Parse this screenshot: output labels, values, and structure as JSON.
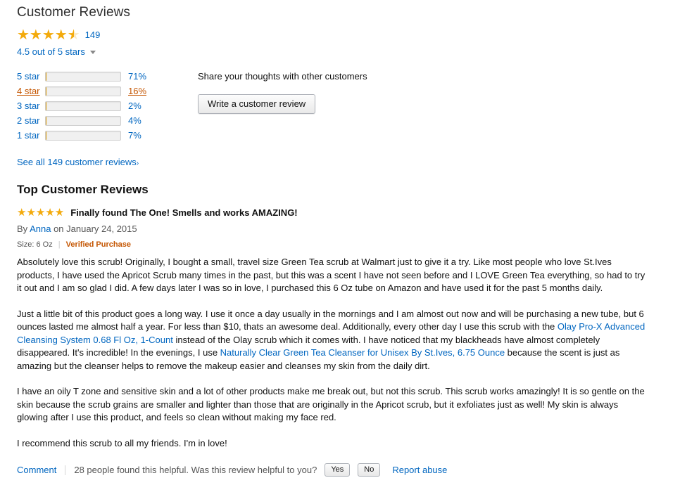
{
  "section": {
    "heading": "Customer Reviews",
    "top_reviews_heading": "Top Customer Reviews"
  },
  "summary": {
    "rating_value": 4.5,
    "rating_max": 5,
    "review_count_label": "149",
    "rating_text": "4.5 out of 5 stars",
    "see_all_label": "See all 149 customer reviews",
    "see_all_arrow": "›"
  },
  "share": {
    "prompt": "Share your thoughts with other customers",
    "write_review_label": "Write a customer review"
  },
  "chart_data": {
    "type": "bar",
    "title": "Customer review rating distribution",
    "xlabel": "",
    "ylabel": "",
    "grid": false,
    "orientation": "horizontal",
    "categories": [
      "5 star",
      "4 star",
      "3 star",
      "2 star",
      "1 star"
    ],
    "values": [
      71,
      16,
      2,
      4,
      7
    ],
    "value_labels": [
      "71%",
      "16%",
      "2%",
      "4%",
      "7%"
    ],
    "xlim": [
      0,
      100
    ],
    "hovered_index": 1,
    "bar_color": "#f9b818",
    "track_color": "#f0f0f0",
    "link_color": "#0066c0",
    "hover_color": "#c45500"
  },
  "review": {
    "rating": 5,
    "title": "Finally found The One! Smells and works AMAZING!",
    "by_prefix": "By",
    "author": "Anna",
    "on_text": "on January 24, 2015",
    "size": "Size: 6 Oz",
    "separator": "|",
    "verified": "Verified Purchase",
    "paragraph1": "Absolutely love this scrub! Originally, I bought a small, travel size Green Tea scrub at Walmart just to give it a try. Like most people who love St.Ives products, I have used the Apricot Scrub many times in the past, but this was a scent I have not seen before and I LOVE Green Tea everything, so had to try it out and I am so glad I did. A few days later I was so in love, I purchased this 6 Oz tube on Amazon and have used it for the past 5 months daily.",
    "paragraph2_part1": "Just a little bit of this product goes a long way. I use it once a day usually in the mornings and I am almost out now and will be purchasing a new tube, but 6 ounces lasted me almost half a year. For less than $10, thats an awesome deal. Additionally, every other day I use this scrub with the ",
    "paragraph2_link1": "Olay Pro-X Advanced Cleansing System 0.68 Fl Oz, 1-Count",
    "paragraph2_part2": " instead of the Olay scrub which it comes with. I have noticed that my blackheads have almost completely disappeared. It's incredible! In the evenings, I use ",
    "paragraph2_link2": "Naturally Clear Green Tea Cleanser for Unisex By St.Ives, 6.75 Ounce",
    "paragraph2_part3": " because the scent is just as amazing but the cleanser helps to remove the makeup easier and cleanses my skin from the daily dirt.",
    "paragraph3": "I have an oily T zone and sensitive skin and a lot of other products make me break out, but not this scrub. This scrub works amazingly! It is so gentle on the skin because the scrub grains are smaller and lighter than those that are originally in the Apricot scrub, but it exfoliates just as well! My skin is always glowing after I use this product, and feels so clean without making my face red.",
    "paragraph4": "I recommend this scrub to all my friends. I'm in love!"
  },
  "review_footer": {
    "comment_label": "Comment",
    "helpful_text": "28 people found this helpful. Was this review helpful to you?",
    "yes_label": "Yes",
    "no_label": "No",
    "report_label": "Report abuse"
  }
}
